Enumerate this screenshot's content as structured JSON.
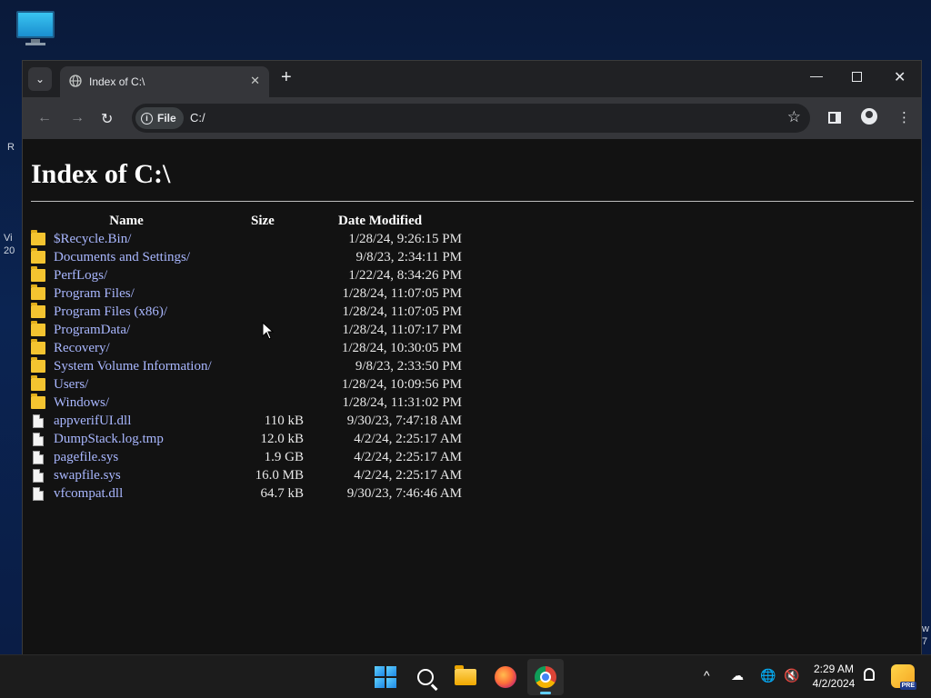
{
  "desktop": {
    "icon": "this-pc-icon",
    "fragments": [
      "R",
      "Vi",
      "20",
      "w",
      "7"
    ]
  },
  "browser": {
    "tab": {
      "title": "Index of C:\\",
      "icon": "globe-icon"
    },
    "new_tab_label": "+",
    "window_controls": {
      "minimize": "—",
      "close": "✕"
    },
    "toolbar": {
      "back": "←",
      "forward": "→",
      "reload": "↻",
      "site_chip_label": "File",
      "url": "C:/",
      "star": "☆",
      "menu": "⋮"
    }
  },
  "page": {
    "heading": "Index of C:\\",
    "columns": {
      "name": "Name",
      "size": "Size",
      "date": "Date Modified"
    },
    "entries": [
      {
        "name": "$Recycle.Bin/",
        "size": "",
        "date": "1/28/24, 9:26:15 PM",
        "type": "folder"
      },
      {
        "name": "Documents and Settings/",
        "size": "",
        "date": "9/8/23, 2:34:11 PM",
        "type": "folder"
      },
      {
        "name": "PerfLogs/",
        "size": "",
        "date": "1/22/24, 8:34:26 PM",
        "type": "folder"
      },
      {
        "name": "Program Files/",
        "size": "",
        "date": "1/28/24, 11:07:05 PM",
        "type": "folder"
      },
      {
        "name": "Program Files (x86)/",
        "size": "",
        "date": "1/28/24, 11:07:05 PM",
        "type": "folder"
      },
      {
        "name": "ProgramData/",
        "size": "",
        "date": "1/28/24, 11:07:17 PM",
        "type": "folder"
      },
      {
        "name": "Recovery/",
        "size": "",
        "date": "1/28/24, 10:30:05 PM",
        "type": "folder"
      },
      {
        "name": "System Volume Information/",
        "size": "",
        "date": "9/8/23, 2:33:50 PM",
        "type": "folder"
      },
      {
        "name": "Users/",
        "size": "",
        "date": "1/28/24, 10:09:56 PM",
        "type": "folder"
      },
      {
        "name": "Windows/",
        "size": "",
        "date": "1/28/24, 11:31:02 PM",
        "type": "folder"
      },
      {
        "name": "appverifUI.dll",
        "size": "110 kB",
        "date": "9/30/23, 7:47:18 AM",
        "type": "file"
      },
      {
        "name": "DumpStack.log.tmp",
        "size": "12.0 kB",
        "date": "4/2/24, 2:25:17 AM",
        "type": "file"
      },
      {
        "name": "pagefile.sys",
        "size": "1.9 GB",
        "date": "4/2/24, 2:25:17 AM",
        "type": "file"
      },
      {
        "name": "swapfile.sys",
        "size": "16.0 MB",
        "date": "4/2/24, 2:25:17 AM",
        "type": "file"
      },
      {
        "name": "vfcompat.dll",
        "size": "64.7 kB",
        "date": "9/30/23, 7:46:46 AM",
        "type": "file"
      }
    ]
  },
  "taskbar": {
    "apps": [
      "start-icon",
      "search-icon",
      "file-explorer-icon",
      "firefox-icon",
      "chrome-icon"
    ],
    "tray_chevron": "^",
    "time": "2:29 AM",
    "date": "4/2/2024",
    "copilot_badge": "PRE"
  },
  "colors": {
    "link": "#a9b7ff",
    "page_bg": "#121212",
    "toolbar_bg": "#35363a",
    "tabbar_bg": "#202124",
    "folder": "#f4c430"
  }
}
